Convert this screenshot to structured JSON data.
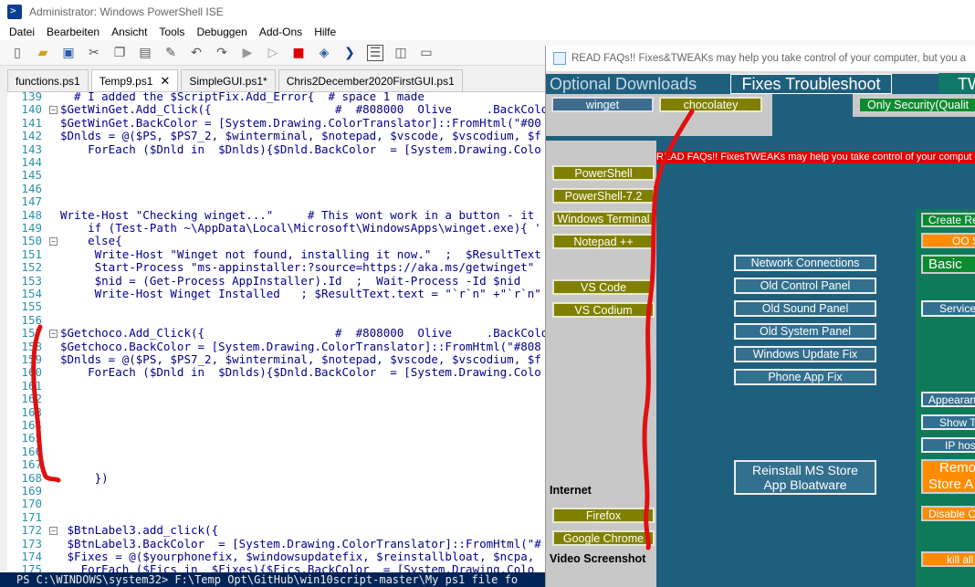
{
  "ise": {
    "title": "Administrator: Windows PowerShell ISE",
    "menu": [
      "Datei",
      "Bearbeiten",
      "Ansicht",
      "Tools",
      "Debuggen",
      "Add-Ons",
      "Hilfe"
    ],
    "tabs": [
      {
        "label": "functions.ps1",
        "active": false
      },
      {
        "label": "Temp9.ps1",
        "active": true,
        "close": "✕"
      },
      {
        "label": "SimpleGUI.ps1*",
        "active": false
      },
      {
        "label": "Chris2December2020FirstGUI.ps1",
        "active": false
      }
    ],
    "lines": [
      {
        "n": "139",
        "text": "  # I added the $ScriptFix.Add_Error{  # space 1 made"
      },
      {
        "n": "140",
        "text": "$GetWinGet.Add_Click({                  #  #808000  Olive     .BackColo"
      },
      {
        "n": "141",
        "text": "$GetWinGet.BackColor = [System.Drawing.ColorTranslator]::FromHtml(\"#00"
      },
      {
        "n": "142",
        "text": "$Dnlds = @($PS, $PS7_2, $winterminal, $notepad, $vscode, $vscodium, $f"
      },
      {
        "n": "143",
        "text": "    ForEach ($Dnld in  $Dnlds){$Dnld.BackColor  = [System.Drawing.Colo"
      },
      {
        "n": "144",
        "text": ""
      },
      {
        "n": "145",
        "text": ""
      },
      {
        "n": "146",
        "text": ""
      },
      {
        "n": "147",
        "text": ""
      },
      {
        "n": "148",
        "text": "Write-Host \"Checking winget...\"     # This wont work in a button - it"
      },
      {
        "n": "149",
        "text": "    if (Test-Path ~\\AppData\\Local\\Microsoft\\WindowsApps\\winget.exe){ '"
      },
      {
        "n": "150",
        "text": "    else{"
      },
      {
        "n": "151",
        "text": "     Write-Host \"Winget not found, installing it now.\"  ;  $ResultText"
      },
      {
        "n": "152",
        "text": "     Start-Process \"ms-appinstaller:?source=https://aka.ms/getwinget\""
      },
      {
        "n": "153",
        "text": "     $nid = (Get-Process AppInstaller).Id  ;  Wait-Process -Id $nid"
      },
      {
        "n": "154",
        "text": "     Write-Host Winget Installed   ; $ResultText.text = \"`r`n\" +\"`r`n\""
      },
      {
        "n": "155",
        "text": ""
      },
      {
        "n": "156",
        "text": ""
      },
      {
        "n": "157",
        "text": "$Getchoco.Add_Click({                   #  #808000  Olive     .BackColor"
      },
      {
        "n": "158",
        "text": "$Getchoco.BackColor = [System.Drawing.ColorTranslator]::FromHtml(\"#808"
      },
      {
        "n": "159",
        "text": "$Dnlds = @($PS, $PS7_2, $winterminal, $notepad, $vscode, $vscodium, $f"
      },
      {
        "n": "160",
        "text": "    ForEach ($Dnld in  $Dnlds){$Dnld.BackColor  = [System.Drawing.Colo"
      },
      {
        "n": "161",
        "text": ""
      },
      {
        "n": "162",
        "text": ""
      },
      {
        "n": "163",
        "text": ""
      },
      {
        "n": "164",
        "text": ""
      },
      {
        "n": "165",
        "text": ""
      },
      {
        "n": "166",
        "text": ""
      },
      {
        "n": "167",
        "text": ""
      },
      {
        "n": "168",
        "text": "     })"
      },
      {
        "n": "169",
        "text": ""
      },
      {
        "n": "170",
        "text": ""
      },
      {
        "n": "171",
        "text": ""
      },
      {
        "n": "172",
        "text": " $BtnLabel3.add_click({"
      },
      {
        "n": "173",
        "text": " $BtnLabel3.BackColor  = [System.Drawing.ColorTranslator]::FromHtml(\"#"
      },
      {
        "n": "174",
        "text": " $Fixes = @($yourphonefix, $windowsupdatefix, $reinstallbloat, $ncpa,"
      },
      {
        "n": "175",
        "text": "   ForEach ($Fics in  $Fixes){$Fics.BackColor  = [System.Drawing.Colo"
      }
    ],
    "console": "PS C:\\WINDOWS\\system32> F:\\Temp Opt\\GitHub\\win10script-master\\My ps1 file fo"
  },
  "gui": {
    "title": "READ FAQs!! Fixes&TWEAKs may help you take control of your computer, but you a",
    "header_optional": "Optional Downloads",
    "header_fixes": "Fixes Troubleshoot",
    "header_tw": "TW",
    "btn_winget": "winget",
    "btn_chocolatey": "chocolatey",
    "btn_only_security": "Only Security(Qualit",
    "marquee": "READ FAQs!! FixesTWEAKs may help you take control of your comput",
    "downloads": [
      "PowerShell",
      "PowerShell-7.2",
      "Windows Terminal",
      "Notepad ++",
      "VS Code",
      "VS Codium"
    ],
    "internet_label": "Internet",
    "btn_firefox": "Firefox",
    "btn_chrome": "Google Chrome",
    "video_label": "Video Screenshot",
    "fixes": [
      "Network Connections",
      "Old Control Panel",
      "Old Sound Panel",
      "Old System Panel",
      "Windows Update Fix",
      "Phone App Fix"
    ],
    "reinstall": [
      "Reinstall MS Store",
      "App Bloatware"
    ],
    "right": {
      "create": "Create Re",
      "oo": "OO S",
      "basic": "Basic",
      "service": "Service",
      "appearance": "Appearan",
      "show": "Show T",
      "ip": "IP hos",
      "remove": [
        "Remo",
        "Store A"
      ],
      "disable": "Disable C",
      "kill": "kill all C"
    }
  }
}
